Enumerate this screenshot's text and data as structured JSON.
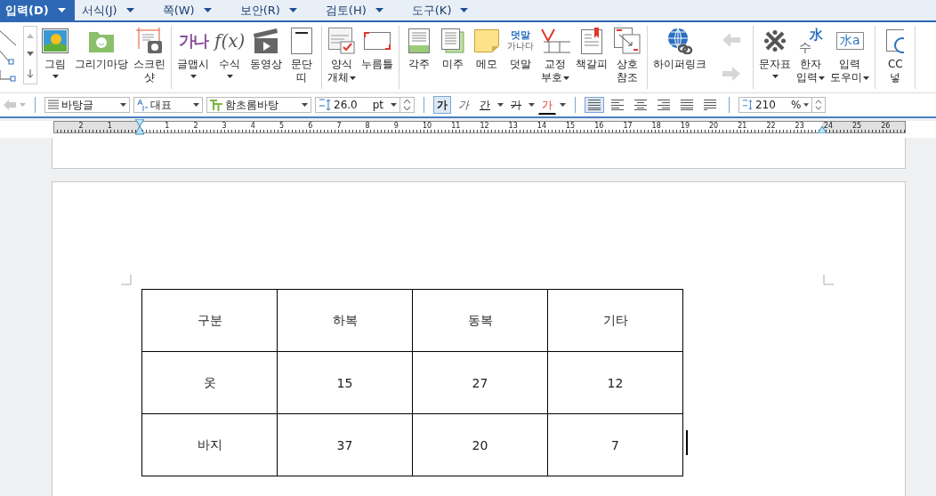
{
  "menu": [
    {
      "label": "입력(D)",
      "selected": true
    },
    {
      "label": "서식(J)",
      "selected": false
    },
    {
      "label": "쪽(W)",
      "selected": false
    },
    {
      "label": "보안(R)",
      "selected": false
    },
    {
      "label": "검토(H)",
      "selected": false
    },
    {
      "label": "도구(K)",
      "selected": false
    }
  ],
  "ribbon": [
    {
      "items": [
        {
          "kind": "gallery"
        },
        {
          "kind": "picture",
          "lines": [
            "그림"
          ],
          "dropdown": true,
          "caret_below": true
        },
        {
          "kind": "folder",
          "lines": [
            "그리기마당"
          ]
        },
        {
          "kind": "screenshot",
          "lines": [
            "스크린",
            "샷"
          ]
        }
      ]
    },
    {
      "items": [
        {
          "kind": "wordart",
          "lines": [
            "글맵시"
          ],
          "dropdown": true,
          "caret_below": true,
          "icon_text": [
            "가나"
          ]
        },
        {
          "kind": "formula",
          "lines": [
            "수식"
          ],
          "dropdown": true,
          "caret_below": true,
          "icon_text": [
            "f(x)"
          ]
        },
        {
          "kind": "video",
          "lines": [
            "동영상"
          ]
        },
        {
          "kind": "band",
          "lines": [
            "문단",
            "띠"
          ]
        }
      ]
    },
    {
      "items": [
        {
          "kind": "form",
          "lines": [
            "양식",
            "개체"
          ],
          "dropdown": true,
          "caret_below": false
        },
        {
          "kind": "field",
          "lines": [
            "누름틀"
          ]
        }
      ]
    },
    {
      "items": [
        {
          "kind": "footnote",
          "lines": [
            "각주"
          ]
        },
        {
          "kind": "endnote",
          "lines": [
            "미주"
          ]
        },
        {
          "kind": "memo",
          "lines": [
            "메모"
          ]
        },
        {
          "kind": "ruby",
          "lines": [
            "덧말"
          ],
          "icon_text": [
            "덧말",
            "가나다"
          ]
        },
        {
          "kind": "proof",
          "lines": [
            "교정",
            "부호"
          ],
          "dropdown": true,
          "caret_below": false
        },
        {
          "kind": "bookmark",
          "lines": [
            "책갈피"
          ]
        },
        {
          "kind": "crossref",
          "lines": [
            "상호",
            "참조"
          ]
        }
      ]
    },
    {
      "items": [
        {
          "kind": "hyperlink",
          "lines": [
            "하이퍼링크"
          ]
        },
        {
          "kind": "nav"
        }
      ]
    },
    {
      "items": [
        {
          "kind": "symbol",
          "lines": [
            "문자표"
          ],
          "dropdown": true,
          "caret_below": true
        },
        {
          "kind": "hanja",
          "lines": [
            "한자",
            "입력"
          ],
          "dropdown": true,
          "caret_below": false,
          "icon_text": [
            "水",
            "수"
          ]
        },
        {
          "kind": "inputhelp",
          "lines": [
            "입력",
            "도우미"
          ],
          "dropdown": true,
          "caret_below": false,
          "icon_text": [
            "水a"
          ]
        }
      ]
    },
    {
      "items": [
        {
          "kind": "cc",
          "lines": [
            "CC",
            "넣"
          ]
        }
      ]
    }
  ],
  "format_bar": {
    "style": "바탕글",
    "language": "대표",
    "font": "함초롬바탕",
    "size": "26.0",
    "size_unit": "pt",
    "char_buttons": [
      {
        "kind": "bold",
        "label": "가",
        "selected": true,
        "dropdown": false
      },
      {
        "kind": "italic",
        "label": "가",
        "selected": false,
        "dropdown": false
      },
      {
        "kind": "underline",
        "label": "간",
        "selected": false,
        "dropdown": true
      },
      {
        "kind": "strike",
        "label": "가",
        "selected": false,
        "dropdown": true
      },
      {
        "kind": "color",
        "label": "가",
        "selected": false,
        "dropdown": true
      }
    ],
    "align_buttons": [
      {
        "kind": "justify",
        "selected": true
      },
      {
        "kind": "left",
        "selected": false
      },
      {
        "kind": "center",
        "selected": false
      },
      {
        "kind": "right",
        "selected": false
      },
      {
        "kind": "distribute",
        "selected": false
      },
      {
        "kind": "split",
        "selected": false
      }
    ],
    "line_spacing": "210",
    "line_spacing_unit": "%"
  },
  "ruler": {
    "left_labels": [
      "2",
      "1"
    ],
    "labels": [
      "1",
      "2",
      "3",
      "4",
      "5",
      "6",
      "7",
      "8",
      "9",
      "10",
      "11",
      "12",
      "13",
      "14",
      "15",
      "16",
      "17",
      "18",
      "19",
      "20",
      "21",
      "22",
      "23",
      "24",
      "25",
      "26"
    ]
  },
  "table": {
    "columns": [
      "구분",
      "하복",
      "동복",
      "기타"
    ],
    "rows": [
      [
        "옷",
        "15",
        "27",
        "12"
      ],
      [
        "바지",
        "37",
        "20",
        "7"
      ]
    ]
  }
}
